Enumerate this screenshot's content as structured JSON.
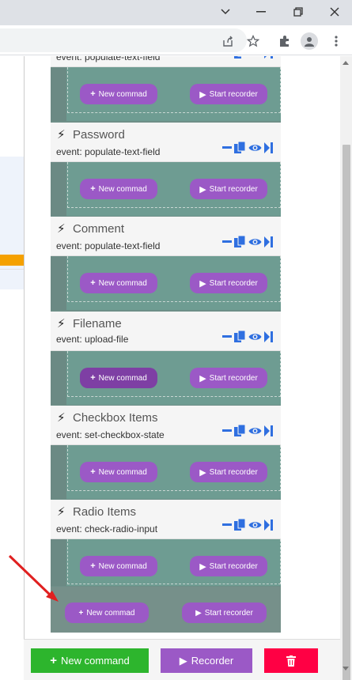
{
  "fields": [
    {
      "name": "",
      "event": "event: populate-text-field"
    },
    {
      "name": "Password",
      "event": "event: populate-text-field"
    },
    {
      "name": "Comment",
      "event": "event: populate-text-field"
    },
    {
      "name": "Filename",
      "event": "event: upload-file"
    },
    {
      "name": "Checkbox Items",
      "event": "event: set-checkbox-state"
    },
    {
      "name": "Radio Items",
      "event": "event: check-radio-input"
    }
  ],
  "labels": {
    "new_command": "New commad",
    "start_recorder": "Start recorder"
  },
  "footer": {
    "new_command": "New command",
    "recorder": "Recorder"
  },
  "icons": {
    "bolt": "lightning-icon",
    "remove": "minus-icon",
    "copy": "copy-icon",
    "view": "eye-icon",
    "skip": "step-forward-icon",
    "delete": "trash-icon"
  },
  "colors": {
    "accent_purple": "#9b59c6",
    "green": "#2db52d",
    "red": "#ff0044",
    "icon_blue": "#2f6fe0"
  }
}
